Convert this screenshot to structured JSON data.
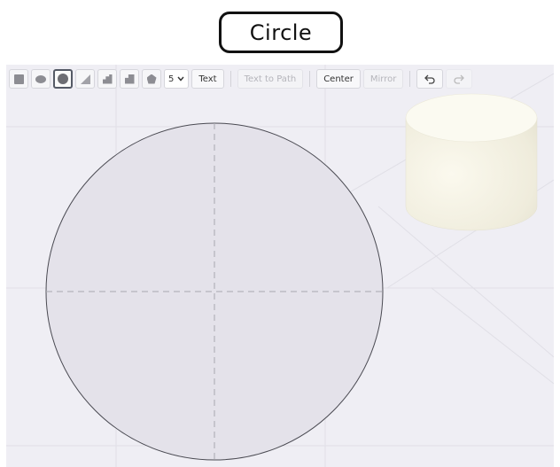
{
  "title": "Circle",
  "toolbar": {
    "shape_tools": [
      {
        "name": "square-tool",
        "icon": "square-icon",
        "active": false
      },
      {
        "name": "ellipse-tool",
        "icon": "ellipse-icon",
        "active": false
      },
      {
        "name": "circle-tool",
        "icon": "circle-icon",
        "active": true
      },
      {
        "name": "triangle-tool",
        "icon": "triangle-icon",
        "active": false
      },
      {
        "name": "stair-tool",
        "icon": "stair-icon",
        "active": false
      },
      {
        "name": "notch-tool",
        "icon": "notch-icon",
        "active": false
      },
      {
        "name": "pentagon-tool",
        "icon": "pentagon-icon",
        "active": false
      }
    ],
    "sides_value": "5",
    "text_label": "Text",
    "text_to_path_label": "Text to Path",
    "center_label": "Center",
    "mirror_label": "Mirror",
    "undo_icon": "undo-icon",
    "redo_icon": "redo-icon"
  },
  "colors": {
    "workspace_bg": "#efeef4",
    "circle_fill": "#e4e2ea",
    "circle_stroke": "#4a4a52",
    "cylinder_body": "#f3f1e3",
    "cylinder_top": "#fbfaf1"
  }
}
